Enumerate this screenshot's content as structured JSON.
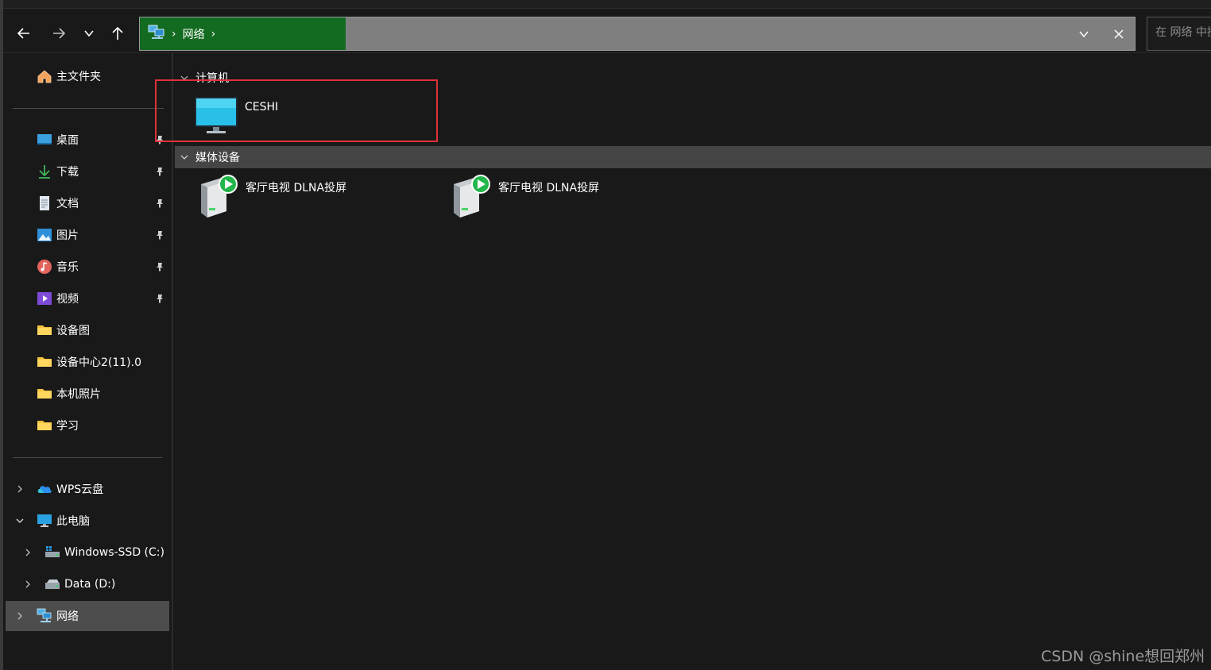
{
  "nav": {
    "back_icon": "arrow-left-icon",
    "forward_icon": "arrow-right-icon",
    "recent_icon": "chevron-down-icon",
    "up_icon": "arrow-up-icon"
  },
  "address": {
    "location_icon": "network-icon",
    "crumb": "网络",
    "separator": "›"
  },
  "search": {
    "placeholder": "在 网络 中搜索"
  },
  "sidebar": {
    "home": "主文件夹",
    "pinned": [
      {
        "label": "桌面",
        "icon": "desktop-icon",
        "pinned": true
      },
      {
        "label": "下载",
        "icon": "download-icon",
        "pinned": true
      },
      {
        "label": "文档",
        "icon": "document-icon",
        "pinned": true
      },
      {
        "label": "图片",
        "icon": "pictures-icon",
        "pinned": true
      },
      {
        "label": "音乐",
        "icon": "music-icon",
        "pinned": true
      },
      {
        "label": "视频",
        "icon": "video-icon",
        "pinned": true
      },
      {
        "label": "设备图",
        "icon": "folder-icon",
        "pinned": false
      },
      {
        "label": "设备中心2(11).0",
        "icon": "folder-icon",
        "pinned": false
      },
      {
        "label": "本机照片",
        "icon": "folder-icon",
        "pinned": false
      },
      {
        "label": "学习",
        "icon": "folder-icon",
        "pinned": false
      }
    ],
    "wps": "WPS云盘",
    "this_pc": "此电脑",
    "drive_c": "Windows-SSD (C:)",
    "drive_d": "Data (D:)",
    "network": "网络"
  },
  "content": {
    "group_computers": "计算机",
    "computers": [
      {
        "name": "CESHI",
        "icon": "monitor-icon"
      }
    ],
    "group_media": "媒体设备",
    "media": [
      {
        "name": "客厅电视 DLNA投屏",
        "icon": "media-server-icon"
      },
      {
        "name": "客厅电视 DLNA投屏",
        "icon": "media-server-icon"
      }
    ]
  },
  "colors": {
    "background": "#191919",
    "address_bar": "#7f7f7f",
    "address_crumb_bg": "#136a21",
    "selection": "#4d4d4d",
    "highlight_box": "#e0313a"
  },
  "watermark": "CSDN @shine想回郑州"
}
